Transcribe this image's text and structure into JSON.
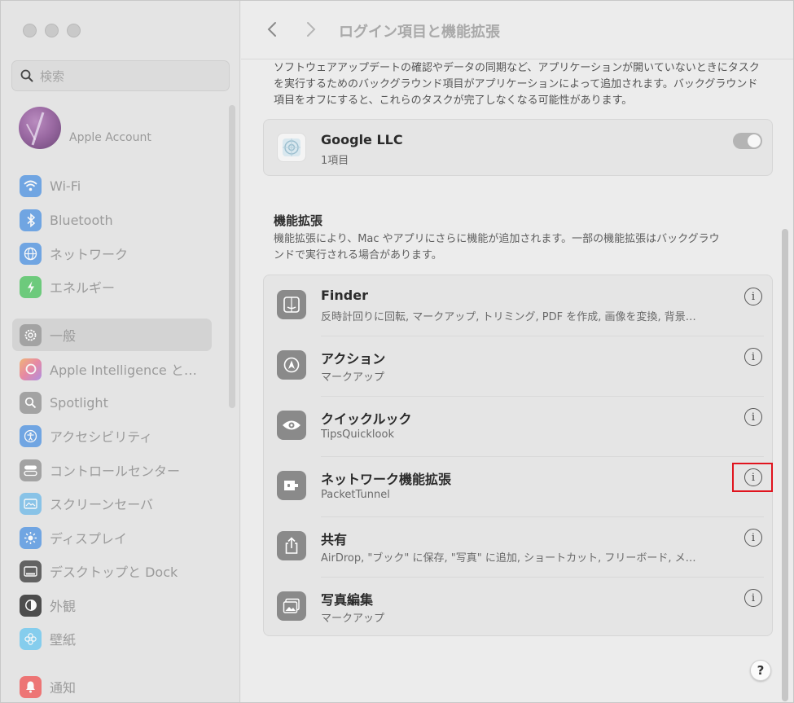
{
  "window": {
    "title": "ログイン項目と機能拡張"
  },
  "search": {
    "placeholder": "検索"
  },
  "account": {
    "label": "Apple Account"
  },
  "sidebar": {
    "items": [
      {
        "label": "Wi-Fi",
        "icon": "wifi-icon",
        "color": "#2f86f6"
      },
      {
        "label": "Bluetooth",
        "icon": "bluetooth-icon",
        "color": "#2f86f6"
      },
      {
        "label": "ネットワーク",
        "icon": "globe-icon",
        "color": "#2f86f6"
      },
      {
        "label": "エネルギー",
        "icon": "battery-icon",
        "color": "#3cbf4f"
      },
      {
        "label": "一般",
        "icon": "gear-icon",
        "color": "#9a9a9a"
      },
      {
        "label": "Apple Intelligence と…",
        "icon": "apple-intelligence-icon",
        "color": "#e86e8a"
      },
      {
        "label": "Spotlight",
        "icon": "magnifier-icon",
        "color": "#9a9a9a"
      },
      {
        "label": "アクセシビリティ",
        "icon": "accessibility-icon",
        "color": "#2f86f6"
      },
      {
        "label": "コントロールセンター",
        "icon": "control-center-icon",
        "color": "#9a9a9a"
      },
      {
        "label": "スクリーンセーバ",
        "icon": "screensaver-icon",
        "color": "#58b0e6"
      },
      {
        "label": "ディスプレイ",
        "icon": "display-icon",
        "color": "#2f86f6"
      },
      {
        "label": "デスクトップと Dock",
        "icon": "dock-icon",
        "color": "#333333"
      },
      {
        "label": "外観",
        "icon": "appearance-icon",
        "color": "#333333"
      },
      {
        "label": "壁紙",
        "icon": "wallpaper-icon",
        "color": "#5fc2f0"
      },
      {
        "label": "通知",
        "icon": "notification-icon",
        "color": "#ef4a4a"
      }
    ],
    "selected_index": 4
  },
  "intro": {
    "text": "ソフトウェアアップデートの確認やデータの同期など、アプリケーションが開いていないときにタスクを実行するためのバックグラウンド項目がアプリケーションによって追加されます。バックグラウンド項目をオフにすると、これらのタスクが完了しなくなる可能性があります。"
  },
  "background_item": {
    "name": "Google LLC",
    "count": "1項目",
    "enabled": true
  },
  "extensions": {
    "title": "機能拡張",
    "description": "機能拡張により、Mac やアプリにさらに機能が追加されます。一部の機能拡張はバックグラウンドで実行される場合があります。",
    "items": [
      {
        "name": "Finder",
        "detail": "反時計回りに回転, マークアップ, トリミング, PDF を作成, 画像を変換, 背景…",
        "icon": "finder-icon"
      },
      {
        "name": "アクション",
        "detail": "マークアップ",
        "icon": "action-icon"
      },
      {
        "name": "クイックルック",
        "detail": "TipsQuicklook",
        "icon": "eye-icon"
      },
      {
        "name": "ネットワーク機能拡張",
        "detail": "PacketTunnel",
        "icon": "network-extension-icon"
      },
      {
        "name": "共有",
        "detail": "AirDrop, \"ブック\" に保存, \"写真\" に追加, ショートカット, フリーボード, メ…",
        "icon": "share-icon"
      },
      {
        "name": "写真編集",
        "detail": "マークアップ",
        "icon": "photo-edit-icon"
      }
    ],
    "highlighted_index": 3
  },
  "help": {
    "label": "?"
  },
  "info_glyph": "i"
}
